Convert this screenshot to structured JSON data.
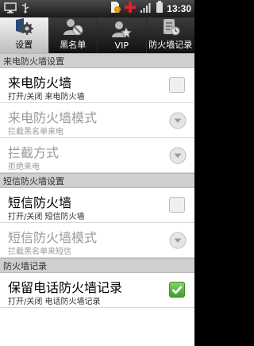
{
  "status_bar": {
    "time": "13:30",
    "icons": [
      "monitor-icon",
      "usb-icon",
      "sim-alert-icon",
      "medical-cross-icon",
      "signal-icon",
      "battery-icon"
    ]
  },
  "tabs": [
    {
      "label": "设置",
      "icon": "gear-shield-icon",
      "active": true
    },
    {
      "label": "黑名单",
      "icon": "blocked-user-icon",
      "active": false
    },
    {
      "label": "VIP",
      "icon": "star-user-icon",
      "active": false
    },
    {
      "label": "防火墙记录",
      "icon": "log-icon",
      "active": false
    }
  ],
  "sections": [
    {
      "header": "来电防火墙设置"
    },
    {
      "header": "短信防火墙设置"
    },
    {
      "header": "防火墙记录"
    }
  ],
  "rows": {
    "call_firewall": {
      "title": "来电防火墙",
      "sub": "打开/关闭 来电防火墙",
      "checked": false
    },
    "call_mode": {
      "title": "来电防火墙模式",
      "sub": "拦截黑名单来电"
    },
    "block_method": {
      "title": "拦截方式",
      "sub": "拒绝来电"
    },
    "sms_firewall": {
      "title": "短信防火墙",
      "sub": "打开/关闭 短信防火墙",
      "checked": false
    },
    "sms_mode": {
      "title": "短信防火墙模式",
      "sub": "拦截黑名单来短信"
    },
    "keep_log": {
      "title": "保留电话防火墙记录",
      "sub": "打开/关闭 电话防火墙记录",
      "checked": true
    }
  },
  "colors": {
    "check_on": "#4caf3a",
    "section_bg": "#cfcfcf"
  }
}
